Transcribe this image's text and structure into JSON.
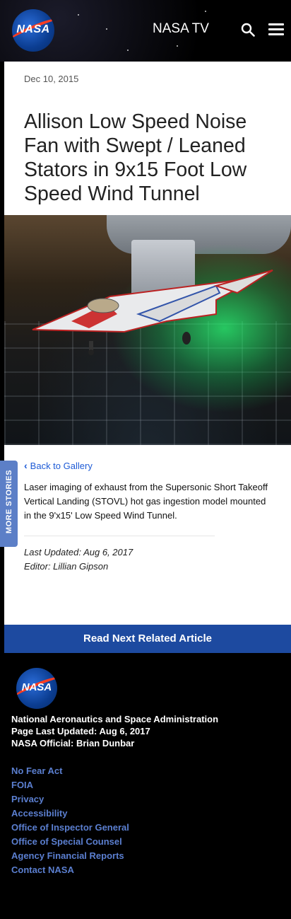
{
  "header": {
    "logo_text": "NASA",
    "nav_label": "NASA TV",
    "search_icon": "search-icon",
    "menu_icon": "hamburger-menu-icon"
  },
  "article": {
    "date": "Dec 10, 2015",
    "title": "Allison Low Speed Noise Fan with Swept / Leaned Stators in 9x15 Foot Low Speed Wind Tunnel",
    "back_link": "Back to Gallery",
    "caption": "Laser imaging of exhaust from the Supersonic Short Takeoff Vertical Landing (STOVL) hot gas ingestion model mounted in the 9'x15' Low Speed Wind Tunnel.",
    "last_updated": "Last Updated: Aug 6, 2017",
    "editor": "Editor: Lillian Gipson"
  },
  "side_tab": {
    "label": "MORE STORIES"
  },
  "read_next": {
    "label": "Read Next Related Article"
  },
  "footer": {
    "logo_text": "NASA",
    "agency_name": "National Aeronautics and Space Administration",
    "page_updated": "Page Last Updated: Aug 6, 2017",
    "official": "NASA Official: Brian Dunbar",
    "links": [
      "No Fear Act",
      "FOIA",
      "Privacy",
      "Accessibility",
      "Office of Inspector General",
      "Office of Special Counsel",
      "Agency Financial Reports",
      "Contact NASA"
    ]
  },
  "colors": {
    "link_blue": "#1e5bd6",
    "read_next_bg": "#1d4aa0",
    "side_tab_bg": "#5c7fc7",
    "footer_link": "#5b7fd0",
    "nasa_red": "#fc3d21"
  }
}
